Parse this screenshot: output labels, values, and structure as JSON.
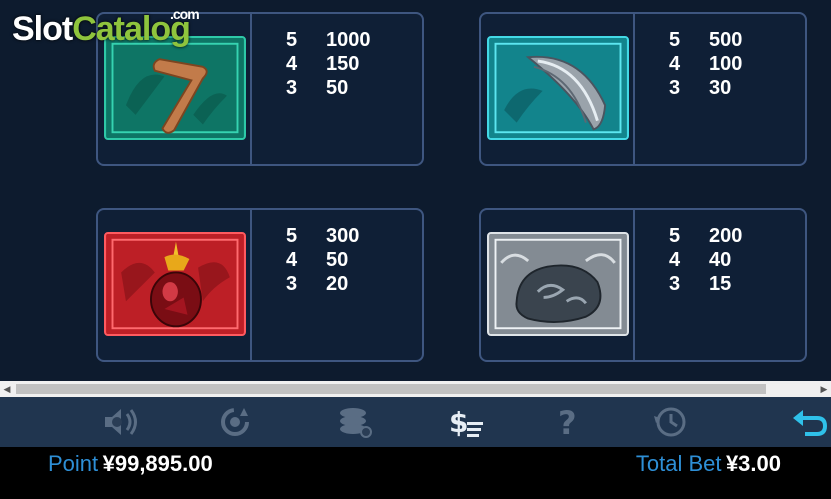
{
  "logo": {
    "slot": "Slot",
    "catalog": "Catalog",
    "com": ".com"
  },
  "paytable": [
    {
      "symbol_icon": "boomerang-icon",
      "rows": [
        {
          "count": "5",
          "pay": "1000"
        },
        {
          "count": "4",
          "pay": "150"
        },
        {
          "count": "3",
          "pay": "50"
        }
      ]
    },
    {
      "symbol_icon": "feather-icon",
      "rows": [
        {
          "count": "5",
          "pay": "500"
        },
        {
          "count": "4",
          "pay": "100"
        },
        {
          "count": "3",
          "pay": "30"
        }
      ]
    },
    {
      "symbol_icon": "red-gem-icon",
      "rows": [
        {
          "count": "5",
          "pay": "300"
        },
        {
          "count": "4",
          "pay": "50"
        },
        {
          "count": "3",
          "pay": "20"
        }
      ]
    },
    {
      "symbol_icon": "stone-icon",
      "rows": [
        {
          "count": "5",
          "pay": "200"
        },
        {
          "count": "4",
          "pay": "40"
        },
        {
          "count": "3",
          "pay": "15"
        }
      ]
    }
  ],
  "toolbar": {
    "icons": [
      "speaker-settings-icon",
      "autoplay-icon",
      "coins-settings-icon",
      "paytable-icon",
      "help-icon",
      "history-icon",
      "back-icon"
    ]
  },
  "status": {
    "point_label": "Point",
    "point_value": "¥99,895.00",
    "total_bet_label": "Total Bet",
    "total_bet_value": "¥3.00"
  },
  "colors": {
    "accent": "#2e8fd6",
    "border": "#3e5680",
    "toolbar": "#20354f",
    "logo_green": "#8fc43d"
  }
}
